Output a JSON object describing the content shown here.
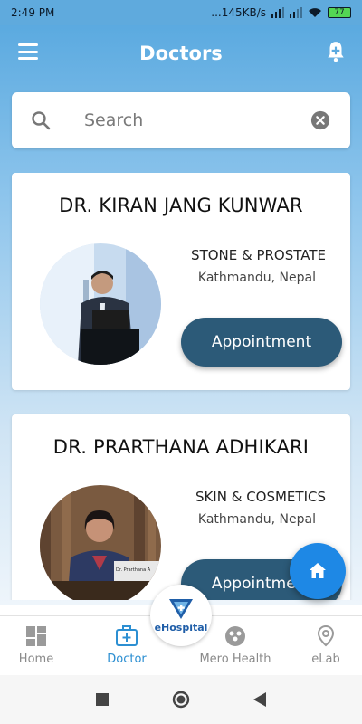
{
  "status_bar": {
    "time": "2:49 PM",
    "network": "...145KB/s",
    "battery": "77"
  },
  "app_bar": {
    "title": "Doctors"
  },
  "search": {
    "placeholder": "Search"
  },
  "doctors": [
    {
      "name": "DR. KIRAN JANG KUNWAR",
      "specialty": "STONE & PROSTATE",
      "location": "Kathmandu, Nepal",
      "button": "Appointment"
    },
    {
      "name": "DR. PRARTHANA ADHIKARI",
      "specialty": "SKIN & COSMETICS",
      "location": "Kathmandu, Nepal",
      "button": "Appointment",
      "photo_caption": "Dr. Prarthana A"
    }
  ],
  "bottom_nav": {
    "items": [
      {
        "label": "Home",
        "icon": "dashboard-icon",
        "active": false
      },
      {
        "label": "Doctor",
        "icon": "medical-kit-icon",
        "active": true
      },
      {
        "label": "Mero Health",
        "icon": "group-icon",
        "active": false
      },
      {
        "label": "eLab",
        "icon": "location-pin-icon",
        "active": false
      }
    ],
    "center_logo": "eHospital"
  },
  "colors": {
    "accent": "#2c5a78",
    "fab": "#1e88e5",
    "active_nav": "#2c8fd2",
    "header_top": "#5baae0"
  }
}
